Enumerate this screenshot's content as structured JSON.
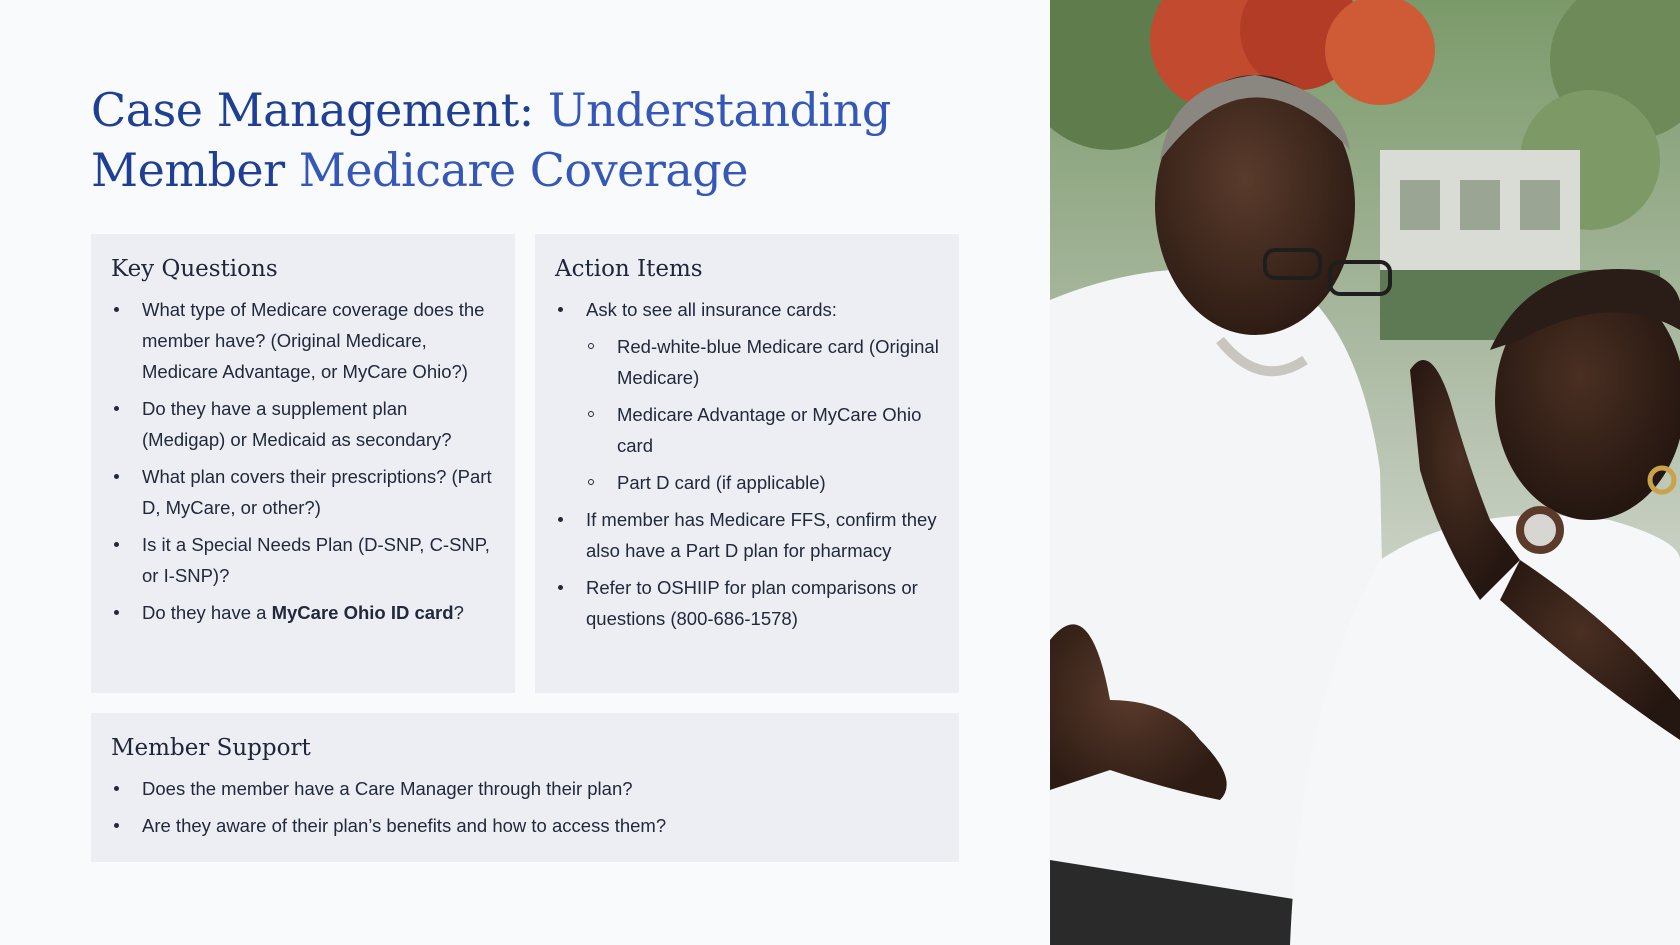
{
  "slide": {
    "title_part1": "Case Management: ",
    "title_part2": "Understanding",
    "title_part3": "Member ",
    "title_part4": "Medicare Coverage"
  },
  "key_questions": {
    "heading": "Key Questions",
    "items": [
      "What type of Medicare coverage does the member have? (Original Medicare, Medicare Advantage, or MyCare Ohio?)",
      "Do they have a supplement plan (Medigap) or Medicaid as secondary?",
      "What plan covers their prescriptions? (Part D, MyCare, or other?)",
      "Is it a Special Needs Plan (D-SNP, C-SNP, or I-SNP)?"
    ],
    "last_item_prefix": "Do they have a ",
    "last_item_bold": "MyCare Ohio ID card",
    "last_item_suffix": "?"
  },
  "action_items": {
    "heading": "Action Items",
    "item1": "Ask to see all insurance cards:",
    "sub1": "Red-white-blue Medicare card (Original Medicare)",
    "sub2": "Medicare Advantage or MyCare Ohio card",
    "sub3": "Part D card (if applicable)",
    "item2": "If member has Medicare FFS, confirm they also have a Part D plan for pharmacy",
    "item3": "Refer to OSHIIP for plan comparisons or questions (800-686-1578)"
  },
  "member_support": {
    "heading": "Member Support",
    "items": [
      "Does the member have a Care Manager through their plan?",
      "Are they aware of their plan’s benefits and how to access them?"
    ]
  },
  "colors": {
    "title_dark": "#1f3f94",
    "title_light": "#3558b8",
    "card_bg": "#eceef4",
    "page_bg": "#f9fafc"
  }
}
